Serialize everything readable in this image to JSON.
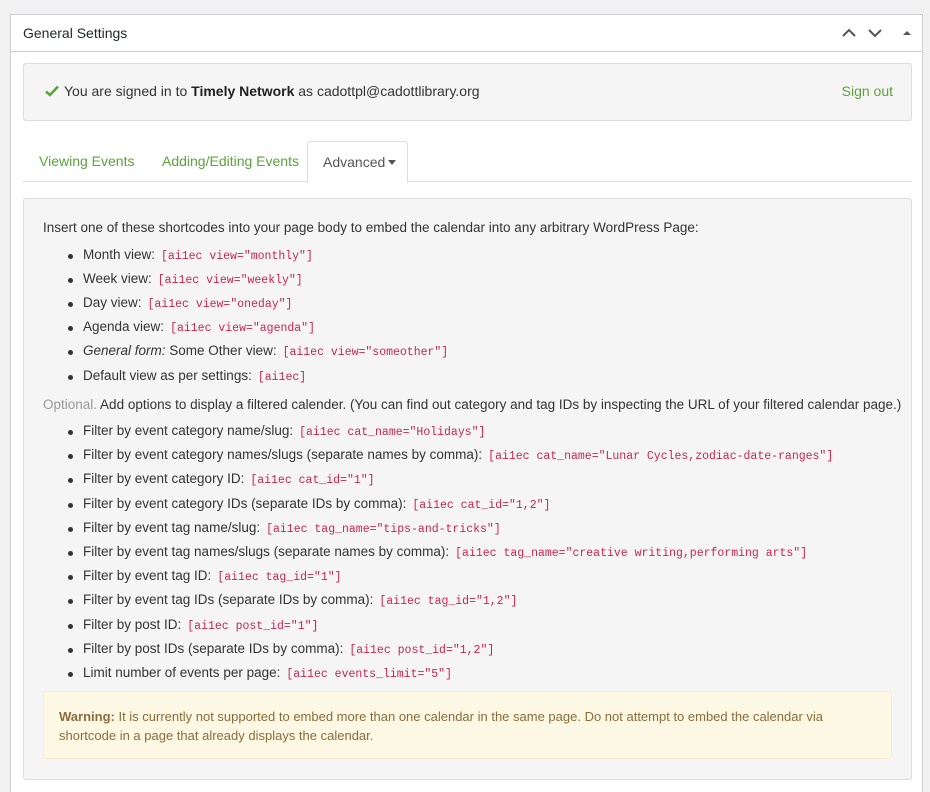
{
  "panel": {
    "title": "General Settings"
  },
  "signin": {
    "prefix": "You are signed in to",
    "network": "Timely Network",
    "as": "as",
    "email": "cadottpl@cadottlibrary.org",
    "signout_label": "Sign out",
    "accent": "#5ba33a"
  },
  "tabs": [
    {
      "label": "Viewing Events"
    },
    {
      "label": "Adding/Editing Events"
    },
    {
      "label": "Advanced"
    }
  ],
  "advanced": {
    "intro": "Insert one of these shortcodes into your page body to embed the calendar into any arbitrary WordPress Page:",
    "views": [
      {
        "label": "Month view:",
        "code": "[ai1ec view=\"monthly\"]"
      },
      {
        "label": "Week view:",
        "code": "[ai1ec view=\"weekly\"]"
      },
      {
        "label": "Day view:",
        "code": "[ai1ec view=\"oneday\"]"
      },
      {
        "label": "Agenda view:",
        "code": "[ai1ec view=\"agenda\"]"
      },
      {
        "label_em": "General form:",
        "label": " Some Other view:",
        "code": "[ai1ec view=\"someother\"]"
      },
      {
        "label": "Default view as per settings:",
        "code": "[ai1ec]"
      }
    ],
    "optional_label": "Optional.",
    "optional_text": " Add options to display a filtered calender. (You can find out category and tag IDs by inspecting the URL of your filtered calendar page.)",
    "filters": [
      {
        "label": "Filter by event category name/slug:",
        "code": "[ai1ec cat_name=\"Holidays\"]"
      },
      {
        "label": "Filter by event category names/slugs (separate names by comma):",
        "code": "[ai1ec cat_name=\"Lunar Cycles,zodiac-date-ranges\"]"
      },
      {
        "label": "Filter by event category ID:",
        "code": "[ai1ec cat_id=\"1\"]"
      },
      {
        "label": "Filter by event category IDs (separate IDs by comma):",
        "code": "[ai1ec cat_id=\"1,2\"]"
      },
      {
        "label": "Filter by event tag name/slug:",
        "code": "[ai1ec tag_name=\"tips-and-tricks\"]"
      },
      {
        "label": "Filter by event tag names/slugs (separate names by comma):",
        "code": "[ai1ec tag_name=\"creative writing,performing arts\"]"
      },
      {
        "label": "Filter by event tag ID:",
        "code": "[ai1ec tag_id=\"1\"]"
      },
      {
        "label": "Filter by event tag IDs (separate IDs by comma):",
        "code": "[ai1ec tag_id=\"1,2\"]"
      },
      {
        "label": "Filter by post ID:",
        "code": "[ai1ec post_id=\"1\"]"
      },
      {
        "label": "Filter by post IDs (separate IDs by comma):",
        "code": "[ai1ec post_id=\"1,2\"]"
      },
      {
        "label": "Limit number of events per page:",
        "code": "[ai1ec events_limit=\"5\"]"
      }
    ],
    "warning_label": "Warning:",
    "warning_text": " It is currently not supported to embed more than one calendar in the same page. Do not attempt to embed the calendar via shortcode in a page that already displays the calendar."
  }
}
